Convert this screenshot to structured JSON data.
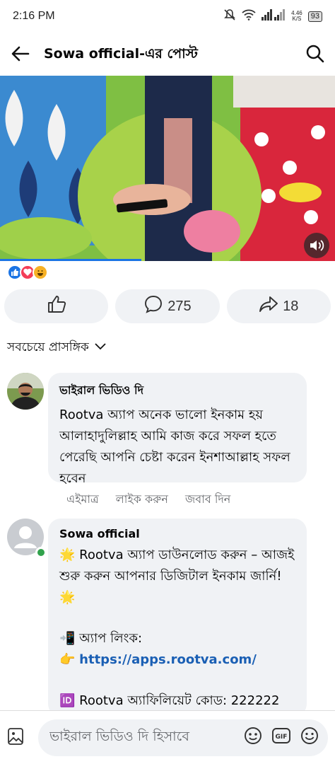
{
  "status_bar": {
    "time": "2:16 PM",
    "speed_top": "4.46",
    "speed_bottom": "K/S",
    "battery": "93"
  },
  "header": {
    "title": "Sowa official-এর পোস্ট"
  },
  "post": {
    "actions": {
      "comment_count": "275",
      "share_count": "18"
    }
  },
  "comments_sort": {
    "label": "সবচেয়ে প্রাসঙ্গিক"
  },
  "comments": [
    {
      "author": "ভাইরাল ভিডিও দি",
      "text": "Rootva অ্যাপ অনেক ভালো ইনকাম হয় আলাহাদুলিল্লাহ আমি কাজ করে সফল হতে পেরেছি আপনি চেষ্টা করেন ইনশাআল্লাহ সফল হবেন",
      "time": "এইমাত্র",
      "like_label": "লাইক করুন",
      "reply_label": "জবাব দিন"
    },
    {
      "author": "Sowa official",
      "line1": "🌟 Rootva অ্যাপ ডাউনলোড করুন – আজই শুরু করুন আপনার ডিজিটাল ইনকাম জার্নি! 🌟",
      "line2": "📲 অ্যাপ লিংক:",
      "link_prefix": "👉",
      "link": "https://apps.rootva.com/",
      "line3": "🆔 Rootva অ্যাফিলিয়েট কোড: 222222"
    }
  ],
  "composer": {
    "placeholder": "ভাইরাল ভিডিও দি হিসাবে"
  },
  "colors": {
    "accent": "#1b74e4",
    "bubble": "#f0f2f5",
    "link": "#1a5fb4",
    "online": "#31a24c"
  }
}
